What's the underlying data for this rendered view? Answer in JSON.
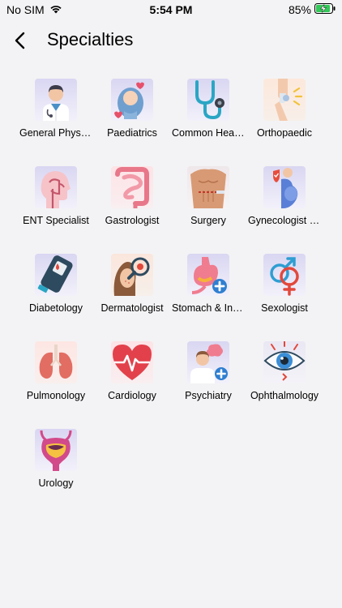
{
  "status": {
    "carrier": "No SIM",
    "time": "5:54 PM",
    "battery": "85%"
  },
  "header": {
    "title": "Specialties"
  },
  "specialties": [
    {
      "label": "General Physician",
      "icon": "doctor-icon"
    },
    {
      "label": "Paediatrics",
      "icon": "baby-icon"
    },
    {
      "label": "Common Health Issues",
      "icon": "stethoscope-icon"
    },
    {
      "label": "Orthopaedic",
      "icon": "knee-joint-icon"
    },
    {
      "label": "ENT Specialist",
      "icon": "ent-head-icon"
    },
    {
      "label": "Gastrologist",
      "icon": "intestine-icon"
    },
    {
      "label": "Surgery",
      "icon": "surgery-torso-icon"
    },
    {
      "label": "Gynecologist and Obstetrics",
      "icon": "pregnant-woman-icon"
    },
    {
      "label": "Diabetology",
      "icon": "glucometer-icon"
    },
    {
      "label": "Dermatologist",
      "icon": "skin-magnifier-icon"
    },
    {
      "label": "Stomach & Intestines",
      "icon": "stomach-icon"
    },
    {
      "label": "Sexologist",
      "icon": "gender-symbols-icon"
    },
    {
      "label": "Pulmonology",
      "icon": "lungs-icon"
    },
    {
      "label": "Cardiology",
      "icon": "heart-pulse-icon"
    },
    {
      "label": "Psychiatry",
      "icon": "brain-doctor-icon"
    },
    {
      "label": "Ophthalmology",
      "icon": "eye-icon"
    },
    {
      "label": "Urology",
      "icon": "bladder-icon"
    }
  ]
}
